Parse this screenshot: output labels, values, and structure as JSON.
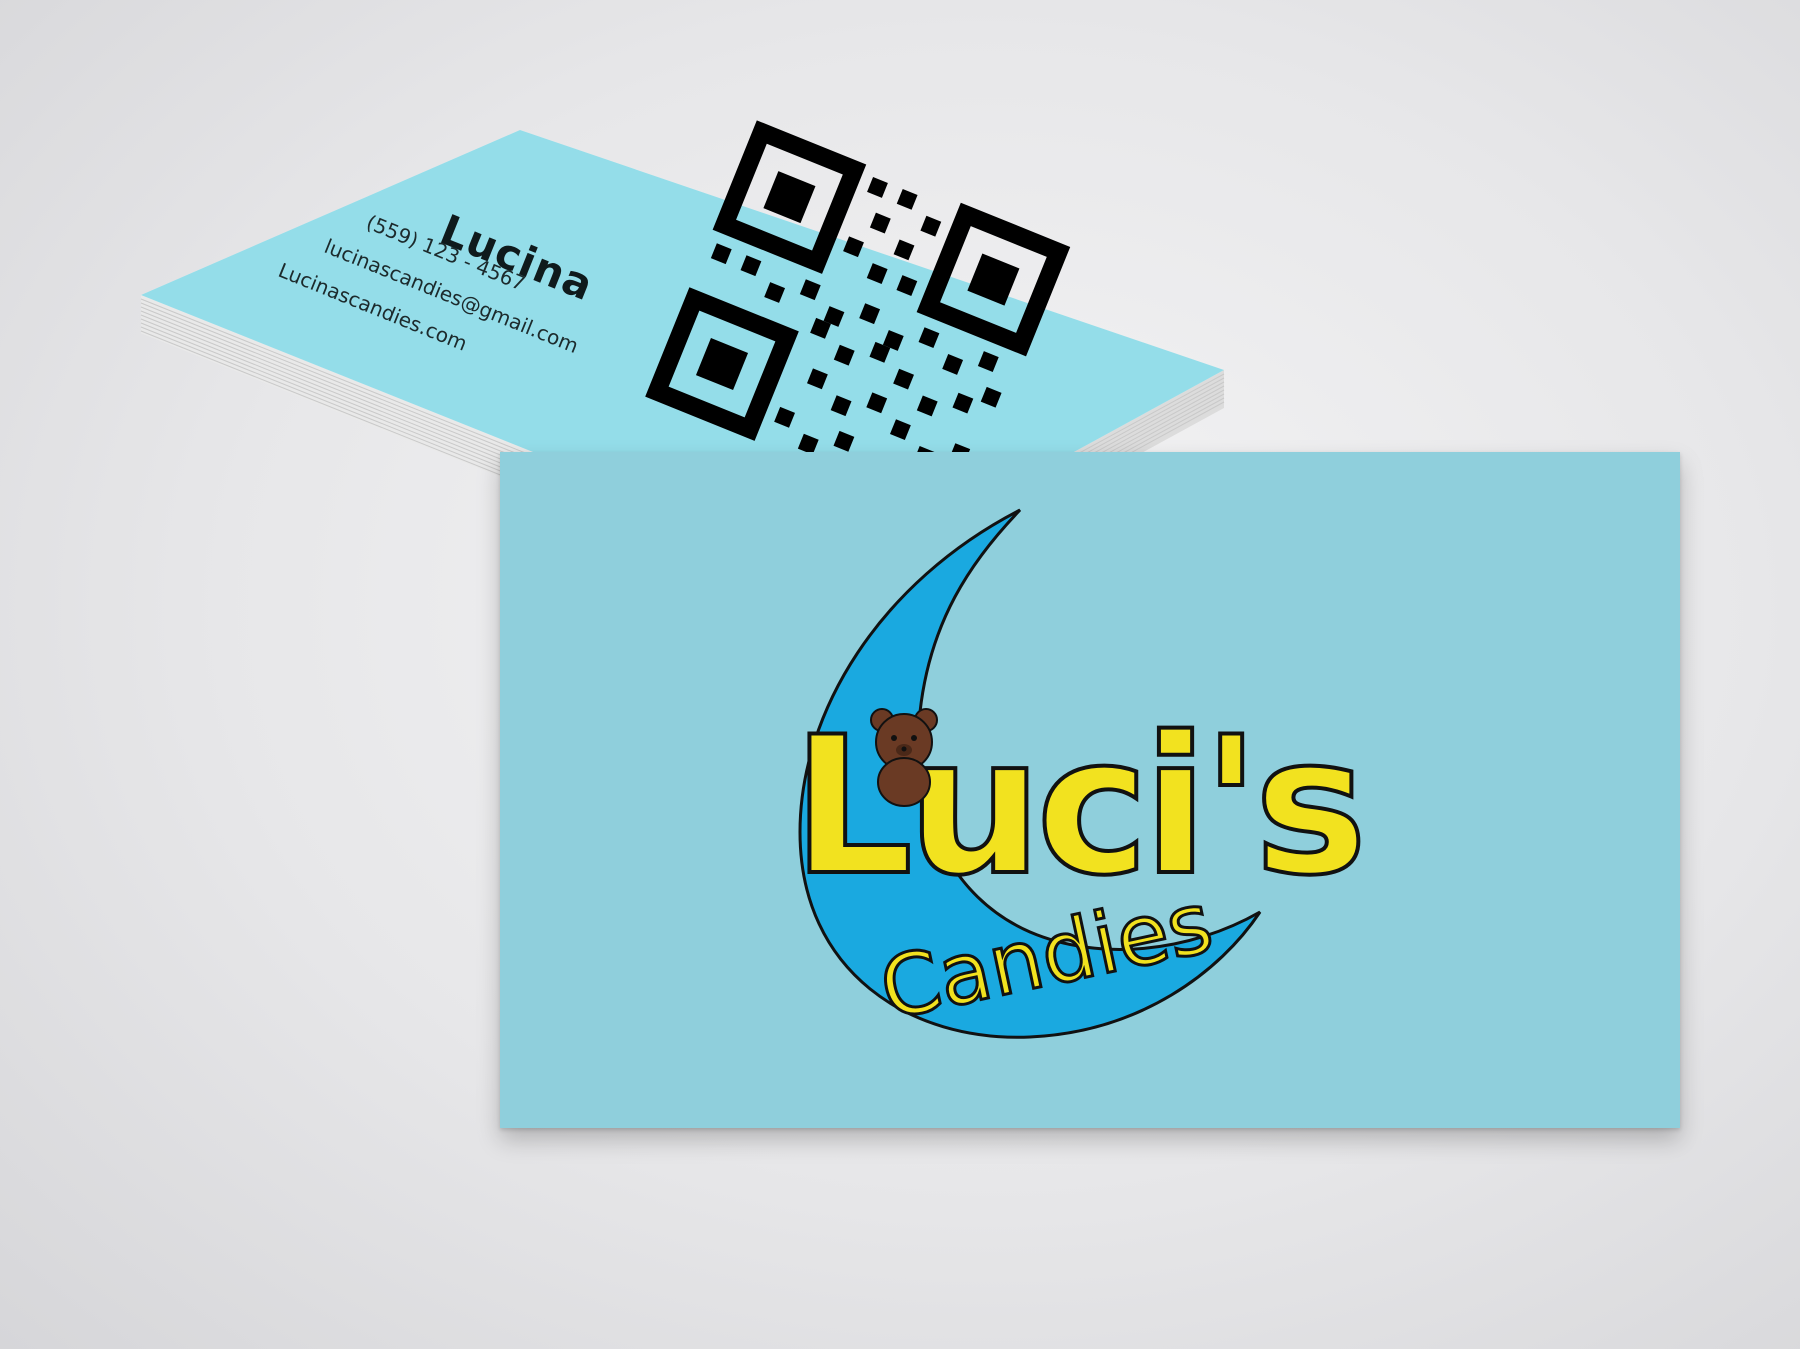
{
  "back_card": {
    "name": "Lucina",
    "phone": "(559) 123 - 4567",
    "email": "lucinascandies@gmail.com",
    "website": "Lucinascandies.com",
    "qr_code": "qr-code-icon"
  },
  "front_card": {
    "logo": {
      "brand": "Luci's",
      "tagline": "Candies",
      "icons": [
        "crescent-moon-icon",
        "teddy-bear-icon"
      ]
    }
  },
  "colors": {
    "background": "#e8e8ea",
    "card_blue": "#8fcfdc",
    "back_card_blue": "#94dde9",
    "moon_blue": "#1aa9e0",
    "letter_yellow": "#f2e21f",
    "bear_brown": "#6a3a24",
    "outline": "#111111"
  }
}
